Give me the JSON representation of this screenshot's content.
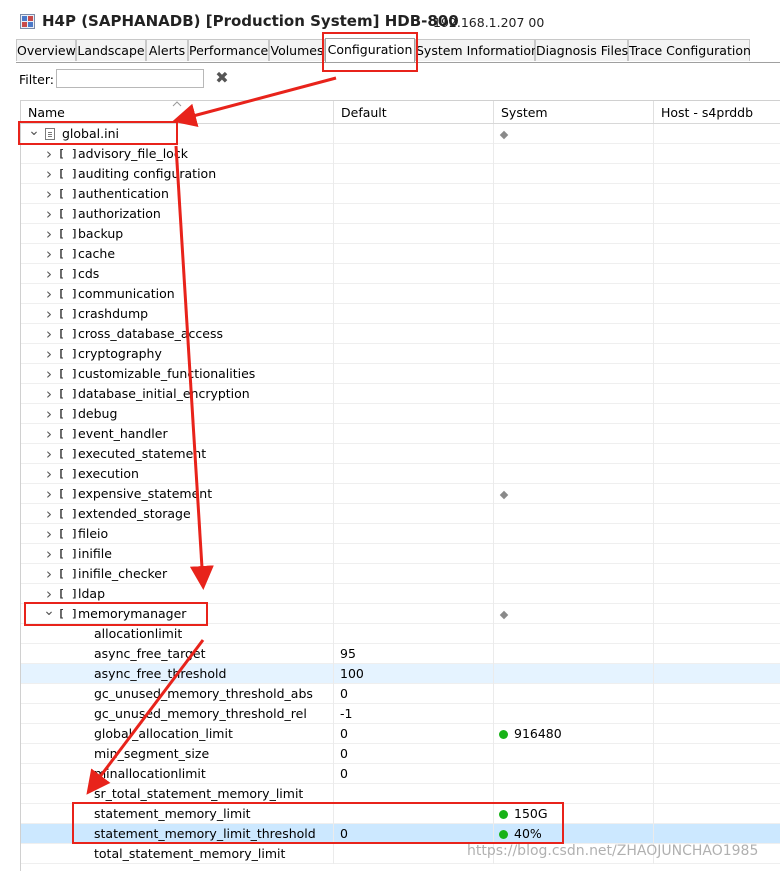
{
  "window": {
    "title": "H4P (SAPHANADB) [Production System] HDB-800",
    "host_info": "192.168.1.207 00"
  },
  "tabs": [
    {
      "label": "Overview"
    },
    {
      "label": "Landscape"
    },
    {
      "label": "Alerts"
    },
    {
      "label": "Performance"
    },
    {
      "label": "Volumes"
    },
    {
      "label": "Configuration",
      "active": true
    },
    {
      "label": "System Information"
    },
    {
      "label": "Diagnosis Files"
    },
    {
      "label": "Trace Configuration"
    }
  ],
  "filter": {
    "label": "Filter:",
    "value": ""
  },
  "columns": {
    "name": "Name",
    "default": "Default",
    "system": "System",
    "host": "Host - s4prddb"
  },
  "root": {
    "label": "global.ini",
    "system_marker": "diamond"
  },
  "sections": [
    {
      "label": "advisory_file_lock"
    },
    {
      "label": "auditing configuration"
    },
    {
      "label": "authentication"
    },
    {
      "label": "authorization"
    },
    {
      "label": "backup"
    },
    {
      "label": "cache"
    },
    {
      "label": "cds"
    },
    {
      "label": "communication"
    },
    {
      "label": "crashdump"
    },
    {
      "label": "cross_database_access"
    },
    {
      "label": "cryptography"
    },
    {
      "label": "customizable_functionalities"
    },
    {
      "label": "database_initial_encryption"
    },
    {
      "label": "debug"
    },
    {
      "label": "event_handler"
    },
    {
      "label": "executed_statement"
    },
    {
      "label": "execution"
    },
    {
      "label": "expensive_statement",
      "system_marker": "diamond"
    },
    {
      "label": "extended_storage"
    },
    {
      "label": "fileio"
    },
    {
      "label": "inifile"
    },
    {
      "label": "inifile_checker"
    },
    {
      "label": "ldap"
    }
  ],
  "expanded_section": {
    "label": "memorymanager",
    "system_marker": "diamond"
  },
  "params": [
    {
      "name": "allocationlimit",
      "default": "",
      "system": ""
    },
    {
      "name": "async_free_target",
      "default": "95",
      "system": ""
    },
    {
      "name": "async_free_threshold",
      "default": "100",
      "system": ""
    },
    {
      "name": "gc_unused_memory_threshold_abs",
      "default": "0",
      "system": ""
    },
    {
      "name": "gc_unused_memory_threshold_rel",
      "default": "-1",
      "system": ""
    },
    {
      "name": "global_allocation_limit",
      "default": "0",
      "system": "916480"
    },
    {
      "name": "min_segment_size",
      "default": "0",
      "system": ""
    },
    {
      "name": "minallocationlimit",
      "default": "0",
      "system": ""
    },
    {
      "name": "sr_total_statement_memory_limit",
      "default": "",
      "system": ""
    },
    {
      "name": "statement_memory_limit",
      "default": "",
      "system": "150G"
    },
    {
      "name": "statement_memory_limit_threshold",
      "default": "0",
      "system": "40%"
    },
    {
      "name": "total_statement_memory_limit",
      "default": "",
      "system": ""
    }
  ],
  "colors": {
    "annotation_red": "#e8231b",
    "status_green": "#18b218",
    "selection_blue": "#cce8ff",
    "hover_blue": "#e5f3ff"
  },
  "watermark": "https://blog.csdn.net/ZHAOJUNCHAO1985"
}
